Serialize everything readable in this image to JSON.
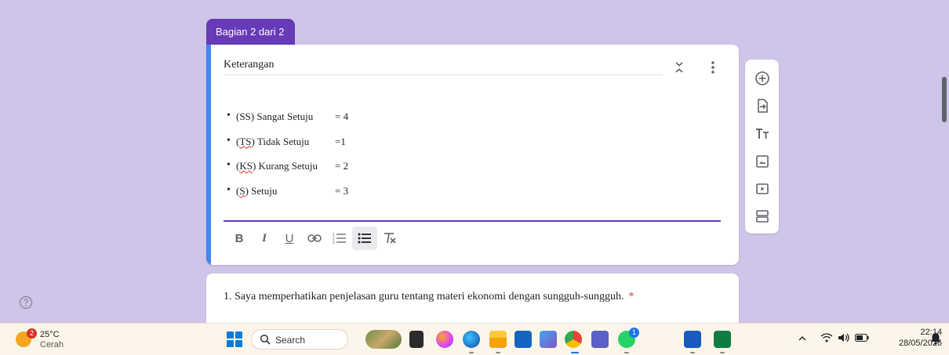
{
  "section": {
    "tab_label": "Bagian 2 dari 2"
  },
  "description_card": {
    "title": "Keterangan",
    "items": [
      {
        "pre": "(SS) Sangat Setuju",
        "value": "= 4"
      },
      {
        "pre": "(",
        "sq": "TS",
        "post": ") Tidak Setuju",
        "value": "=1"
      },
      {
        "pre": "(",
        "sq": "KS",
        "post": ") Kurang Setuju",
        "value": "= 2"
      },
      {
        "pre": "(",
        "sq": "S",
        "post": ") Setuju",
        "value": "= 3"
      }
    ],
    "toolbar": {
      "bold": "B",
      "italic": "I",
      "underline": "U",
      "bulleted_list_active": true
    }
  },
  "side_toolbar": {
    "icons": [
      "add-question-icon",
      "import-questions-icon",
      "add-title-icon",
      "add-image-icon",
      "add-video-icon",
      "add-section-icon"
    ]
  },
  "question": {
    "text": "1. Saya memperhatikan penjelasan guru tentang materi ekonomi dengan sungguh-sungguh.",
    "required_mark": "*"
  },
  "taskbar": {
    "weather_badge": "2",
    "temperature": "25°C",
    "condition": "Cerah",
    "search_label": "Search",
    "notification_badge": "1",
    "time": "22:14",
    "date": "28/05/2026"
  },
  "colors": {
    "background": "#cfc5e9",
    "accent_purple": "#673ab7",
    "accent_blue": "#4285f4",
    "required_red": "#d93025"
  }
}
